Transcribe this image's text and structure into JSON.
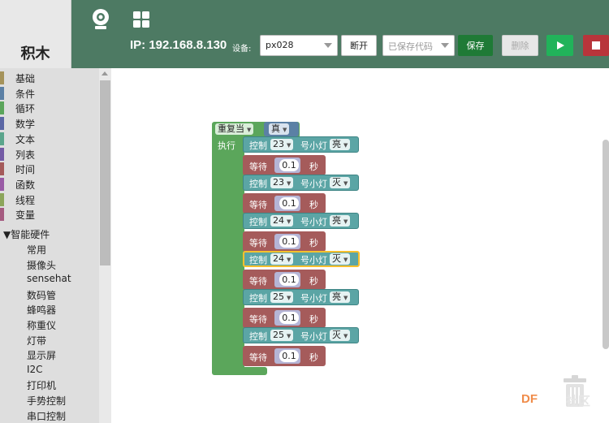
{
  "app": {
    "title": "积木"
  },
  "toolbar": {
    "ip_label": "IP: 192.168.8.130",
    "device_label": "设备:",
    "device_value": "px028",
    "disconnect_label": "断开",
    "saved_code_placeholder": "已保存代码",
    "save_label": "保存",
    "delete_label": "删除",
    "icons": [
      "webcam-icon",
      "grid-icon",
      "play-icon",
      "stop-icon"
    ]
  },
  "sidebar": {
    "categories": [
      {
        "label": "基础",
        "color": "#a5935b"
      },
      {
        "label": "条件",
        "color": "#5b80a5"
      },
      {
        "label": "循环",
        "color": "#5ba55b"
      },
      {
        "label": "数学",
        "color": "#5b67a5"
      },
      {
        "label": "文本",
        "color": "#5ba58c"
      },
      {
        "label": "列表",
        "color": "#745ba5"
      },
      {
        "label": "时间",
        "color": "#a55b5b"
      },
      {
        "label": "函数",
        "color": "#995ba5"
      },
      {
        "label": "线程",
        "color": "#8ca55b"
      },
      {
        "label": "变量",
        "color": "#a55b80"
      }
    ],
    "hardware_header": "▼智能硬件",
    "hardware_items": [
      "常用",
      "摄像头",
      "sensehat",
      "数码管",
      "蜂鸣器",
      "称重仪",
      "灯带",
      "显示屏",
      "I2C",
      "打印机",
      "手势控制",
      "串口控制"
    ]
  },
  "workspace": {
    "loop": {
      "label": "重复当",
      "condition": "真",
      "do_label": "执行"
    },
    "statements": [
      {
        "type": "control",
        "label": "控制",
        "pin": "23",
        "mid": "号小灯",
        "state": "亮"
      },
      {
        "type": "wait",
        "label": "等待",
        "value": "0.1",
        "unit": "秒"
      },
      {
        "type": "control",
        "label": "控制",
        "pin": "23",
        "mid": "号小灯",
        "state": "灭"
      },
      {
        "type": "wait",
        "label": "等待",
        "value": "0.1",
        "unit": "秒"
      },
      {
        "type": "control",
        "label": "控制",
        "pin": "24",
        "mid": "号小灯",
        "state": "亮"
      },
      {
        "type": "wait",
        "label": "等待",
        "value": "0.1",
        "unit": "秒"
      },
      {
        "type": "control",
        "label": "控制",
        "pin": "24",
        "mid": "号小灯",
        "state": "灭"
      },
      {
        "type": "wait",
        "label": "等待",
        "value": "0.1",
        "unit": "秒"
      },
      {
        "type": "control",
        "label": "控制",
        "pin": "25",
        "mid": "号小灯",
        "state": "亮"
      },
      {
        "type": "wait",
        "label": "等待",
        "value": "0.1",
        "unit": "秒"
      },
      {
        "type": "control",
        "label": "控制",
        "pin": "25",
        "mid": "号小灯",
        "state": "灭"
      },
      {
        "type": "wait",
        "label": "等待",
        "value": "0.1",
        "unit": "秒"
      }
    ],
    "watermark": "DF",
    "watermark_faded": "社区"
  }
}
